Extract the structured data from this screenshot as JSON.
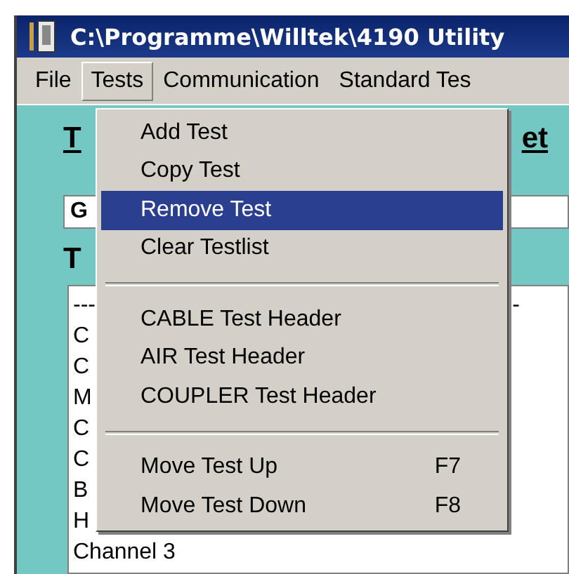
{
  "window": {
    "title": "C:\\Programme\\Willtek\\4190 Utility"
  },
  "menu_bar": [
    {
      "label": "File",
      "selected": false
    },
    {
      "label": "Tests",
      "selected": true
    },
    {
      "label": "Communication",
      "selected": false
    },
    {
      "label": "Standard Tes",
      "selected": false
    }
  ],
  "panel": {
    "heading_1": "T",
    "heading_1_end": "et",
    "field_value": "G",
    "heading_2": "T",
    "list": [
      {
        "text": "---",
        "tail": "-"
      },
      {
        "text": "C"
      },
      {
        "text": "C"
      },
      {
        "text": "M"
      },
      {
        "text": "C"
      },
      {
        "text": "C"
      },
      {
        "text": "B"
      },
      {
        "text": "H"
      },
      {
        "text": "Channel 3"
      }
    ]
  },
  "dropdown": [
    {
      "kind": "item",
      "label": "Add Test",
      "selected": false
    },
    {
      "kind": "item",
      "label": "Copy Test",
      "selected": false
    },
    {
      "kind": "item",
      "label": "Remove Test",
      "selected": true
    },
    {
      "kind": "item",
      "label": "Clear Testlist",
      "selected": false
    },
    {
      "kind": "separator"
    },
    {
      "kind": "item",
      "label": "CABLE Test Header",
      "selected": false
    },
    {
      "kind": "item",
      "label": "AIR Test Header",
      "selected": false
    },
    {
      "kind": "item",
      "label": "COUPLER Test Header",
      "selected": false
    },
    {
      "kind": "separator"
    },
    {
      "kind": "item",
      "label": "Move Test Up",
      "shortcut": "F7",
      "selected": false
    },
    {
      "kind": "item",
      "label": "Move Test Down",
      "shortcut": "F8",
      "selected": false
    }
  ]
}
